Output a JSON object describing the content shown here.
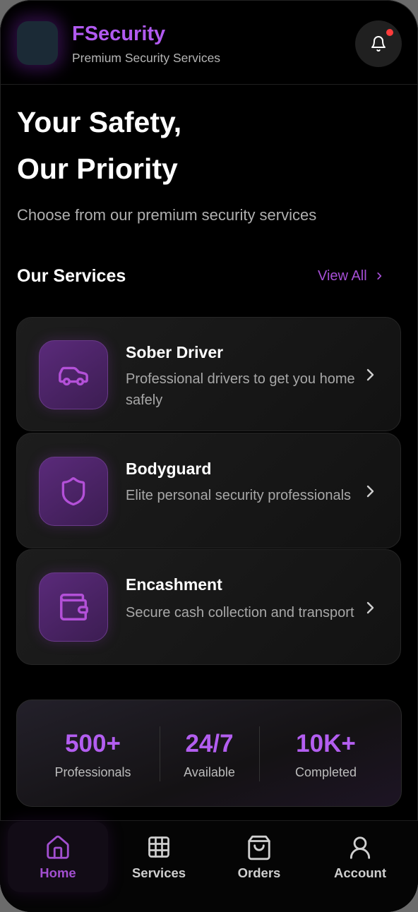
{
  "header": {
    "brand_title": "FSecurity",
    "brand_subtitle": "Premium Security Services",
    "notification_icon": "bell-icon",
    "has_unread": true
  },
  "hero": {
    "title_line1": "Your Safety,",
    "title_line2": "Our Priority",
    "subtitle": "Choose from our premium security services"
  },
  "services": {
    "section_title": "Our Services",
    "view_all_label": "View All",
    "items": [
      {
        "icon": "car-icon",
        "title": "Sober Driver",
        "description": "Professional drivers to get you home safely"
      },
      {
        "icon": "shield-icon",
        "title": "Bodyguard",
        "description": "Elite personal security professionals"
      },
      {
        "icon": "wallet-icon",
        "title": "Encashment",
        "description": "Secure cash collection and transport"
      }
    ]
  },
  "stats": [
    {
      "value": "500+",
      "label": "Professionals"
    },
    {
      "value": "24/7",
      "label": "Available"
    },
    {
      "value": "10K+",
      "label": "Completed"
    }
  ],
  "tabbar": {
    "tabs": [
      {
        "label": "Home",
        "icon": "home-icon",
        "active": true
      },
      {
        "label": "Services",
        "icon": "grid-icon",
        "active": false
      },
      {
        "label": "Orders",
        "icon": "shopping-bag-icon",
        "active": false
      },
      {
        "label": "Account",
        "icon": "user-icon",
        "active": false
      }
    ]
  },
  "colors": {
    "accent": "#b15af0",
    "background": "#000000",
    "card": "#1a1a1a",
    "notification_dot": "#ff3b3b"
  }
}
